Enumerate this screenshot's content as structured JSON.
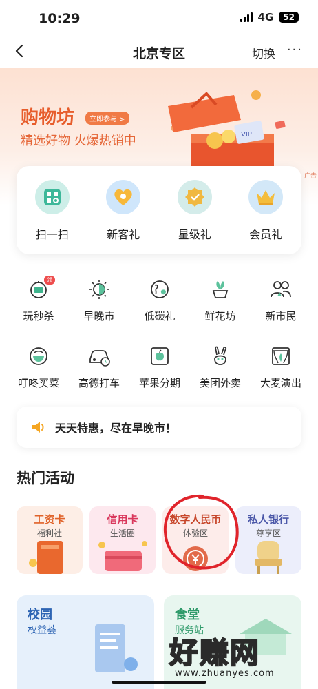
{
  "status_bar": {
    "time": "10:29",
    "network": "4G",
    "battery": "52"
  },
  "nav": {
    "title": "北京专区",
    "switch_label": "切换",
    "more_label": "···"
  },
  "banner": {
    "title": "购物坊",
    "badge": "立即参与 >",
    "subtitle": "精选好物 火爆热销中",
    "ad_tag": "广告",
    "accent": "#e75d2c"
  },
  "quick_actions": [
    {
      "label": "扫一扫",
      "icon": "scan-icon"
    },
    {
      "label": "新客礼",
      "icon": "heart-icon"
    },
    {
      "label": "星级礼",
      "icon": "star-badge-icon"
    },
    {
      "label": "会员礼",
      "icon": "crown-icon"
    }
  ],
  "services": [
    {
      "label": "玩秒杀",
      "icon": "flash-sale-icon",
      "badge": "领"
    },
    {
      "label": "早晚市",
      "icon": "sun-moon-icon"
    },
    {
      "label": "低碳礼",
      "icon": "earth-icon"
    },
    {
      "label": "鲜花坊",
      "icon": "flower-pot-icon"
    },
    {
      "label": "新市民",
      "icon": "people-icon"
    },
    {
      "label": "叮咚买菜",
      "icon": "bowl-icon"
    },
    {
      "label": "高德打车",
      "icon": "car-icon"
    },
    {
      "label": "苹果分期",
      "icon": "apple-icon"
    },
    {
      "label": "美团外卖",
      "icon": "rabbit-icon"
    },
    {
      "label": "大麦演出",
      "icon": "theater-icon"
    }
  ],
  "notice": {
    "text": "天天特惠，尽在早晚市！",
    "icon": "speaker-icon"
  },
  "hot_section": {
    "title": "热门活动",
    "cards": [
      {
        "title": "工资卡",
        "subtitle": "福利社",
        "title_color": "#e0632a",
        "bg": "#fdeee6"
      },
      {
        "title": "信用卡",
        "subtitle": "生活圈",
        "title_color": "#d9375c",
        "bg": "#fde8ee"
      },
      {
        "title": "数字人民币",
        "subtitle": "体验区",
        "title_color": "#c7462a",
        "bg": "#fdecea"
      },
      {
        "title": "私人银行",
        "subtitle": "尊享区",
        "title_color": "#4a57a8",
        "bg": "#eceefb"
      }
    ]
  },
  "bottom_cards": [
    {
      "title": "校园",
      "subtitle": "权益荟",
      "title_color": "#2d64b3",
      "bg": "#e6f0fb"
    },
    {
      "title": "食堂",
      "subtitle": "服务站",
      "title_color": "#2f9a6a",
      "bg": "#e8f6ef"
    }
  ],
  "watermark": {
    "main": "好赚网",
    "url": "www.zhuanyes.com"
  }
}
